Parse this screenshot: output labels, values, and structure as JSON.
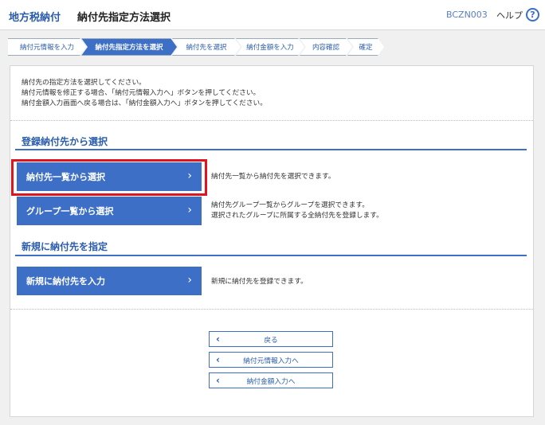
{
  "header": {
    "brand": "地方税納付",
    "title": "納付先指定方法選択",
    "screen_id": "BCZN003",
    "help_label": "ヘルプ",
    "help_icon": "?"
  },
  "steps": [
    {
      "label": "納付元情報を入力",
      "active": false
    },
    {
      "label": "納付先指定方法を選択",
      "active": true
    },
    {
      "label": "納付先を選択",
      "active": false
    },
    {
      "label": "納付金額を入力",
      "active": false
    },
    {
      "label": "内容確認",
      "active": false
    },
    {
      "label": "確定",
      "active": false
    }
  ],
  "instructions": [
    "納付先の指定方法を選択してください。",
    "納付元情報を修正する場合、「納付元情報入力へ」ボタンを押してください。",
    "納付金額入力画面へ戻る場合は、「納付金額入力へ」ボタンを押してください。"
  ],
  "section_registered": {
    "title": "登録納付先から選択",
    "buttons": [
      {
        "label": "納付先一覧から選択",
        "chevron": "›",
        "desc": [
          "納付先一覧から納付先を選択できます。"
        ]
      },
      {
        "label": "グループ一覧から選択",
        "chevron": "›",
        "desc": [
          "納付先グループ一覧からグループを選択できます。",
          "選択されたグループに所属する全納付先を登録します。"
        ]
      }
    ]
  },
  "section_new": {
    "title": "新規に納付先を指定",
    "button": {
      "label": "新規に納付先を入力",
      "chevron": "›",
      "desc": [
        "新規に納付先を登録できます。"
      ]
    }
  },
  "footer_buttons": [
    {
      "label": "戻る",
      "chevron": "‹"
    },
    {
      "label": "納付元情報入力へ",
      "chevron": "‹"
    },
    {
      "label": "納付金額入力へ",
      "chevron": "‹"
    }
  ],
  "colors": {
    "accent": "#3d6fc6",
    "brand": "#2a5cad",
    "highlight": "#e0141e"
  }
}
